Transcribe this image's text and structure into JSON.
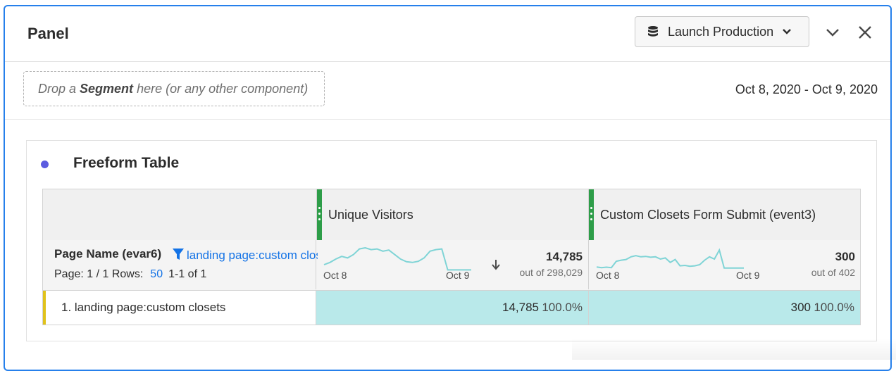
{
  "panel": {
    "title": "Panel",
    "report_suite": "Launch Production",
    "segment_drop": {
      "prefix": "Drop a ",
      "bold": "Segment",
      "suffix": " here (or any other component)"
    },
    "date_range": "Oct 8, 2020 - Oct 9, 2020"
  },
  "visualization": {
    "title": "Freeform Table",
    "dot_color": "#5c5ce0"
  },
  "table": {
    "dimension": {
      "name": "Page Name (evar6)",
      "filter": "landing page:custom closets",
      "page_label": "Page: 1 / 1 Rows:",
      "rows": "50",
      "range": "1-1 of 1"
    },
    "metrics": [
      {
        "name": "Unique Visitors",
        "total": "14,785",
        "out_of": "out of 298,029",
        "spark_start": "Oct 8",
        "spark_end": "Oct 9",
        "sorted": true,
        "spark": [
          0.25,
          0.35,
          0.5,
          0.62,
          0.55,
          0.7,
          0.95,
          1.0,
          0.92,
          0.95,
          0.85,
          0.9,
          0.7,
          0.5,
          0.38,
          0.35,
          0.4,
          0.55,
          0.85,
          0.92,
          0.95,
          0.02,
          0.02,
          0.02,
          0.02,
          0.02
        ]
      },
      {
        "name": "Custom Closets Form Submit (event3)",
        "total": "300",
        "out_of": "out of 402",
        "spark_start": "Oct 8",
        "spark_end": "Oct 9",
        "sorted": false,
        "spark": [
          0.15,
          0.12,
          0.14,
          0.12,
          0.4,
          0.45,
          0.48,
          0.6,
          0.65,
          0.6,
          0.62,
          0.58,
          0.6,
          0.5,
          0.55,
          0.35,
          0.48,
          0.2,
          0.22,
          0.18,
          0.2,
          0.25,
          0.45,
          0.6,
          0.5,
          0.9,
          0.1,
          0.1,
          0.1,
          0.1,
          0.1
        ]
      }
    ],
    "rows_data": [
      {
        "label": "1. landing page:custom closets",
        "values": [
          {
            "value": "14,785",
            "pct": "100.0%"
          },
          {
            "value": "300",
            "pct": "100.0%"
          }
        ]
      }
    ]
  },
  "colors": {
    "accent": "#2680eb",
    "link": "#1473e6",
    "grip": "#2d9d48",
    "cell_fill": "#b9e9ea",
    "sparkline": "#7fd4d6",
    "row_marker": "#e0c21b"
  }
}
